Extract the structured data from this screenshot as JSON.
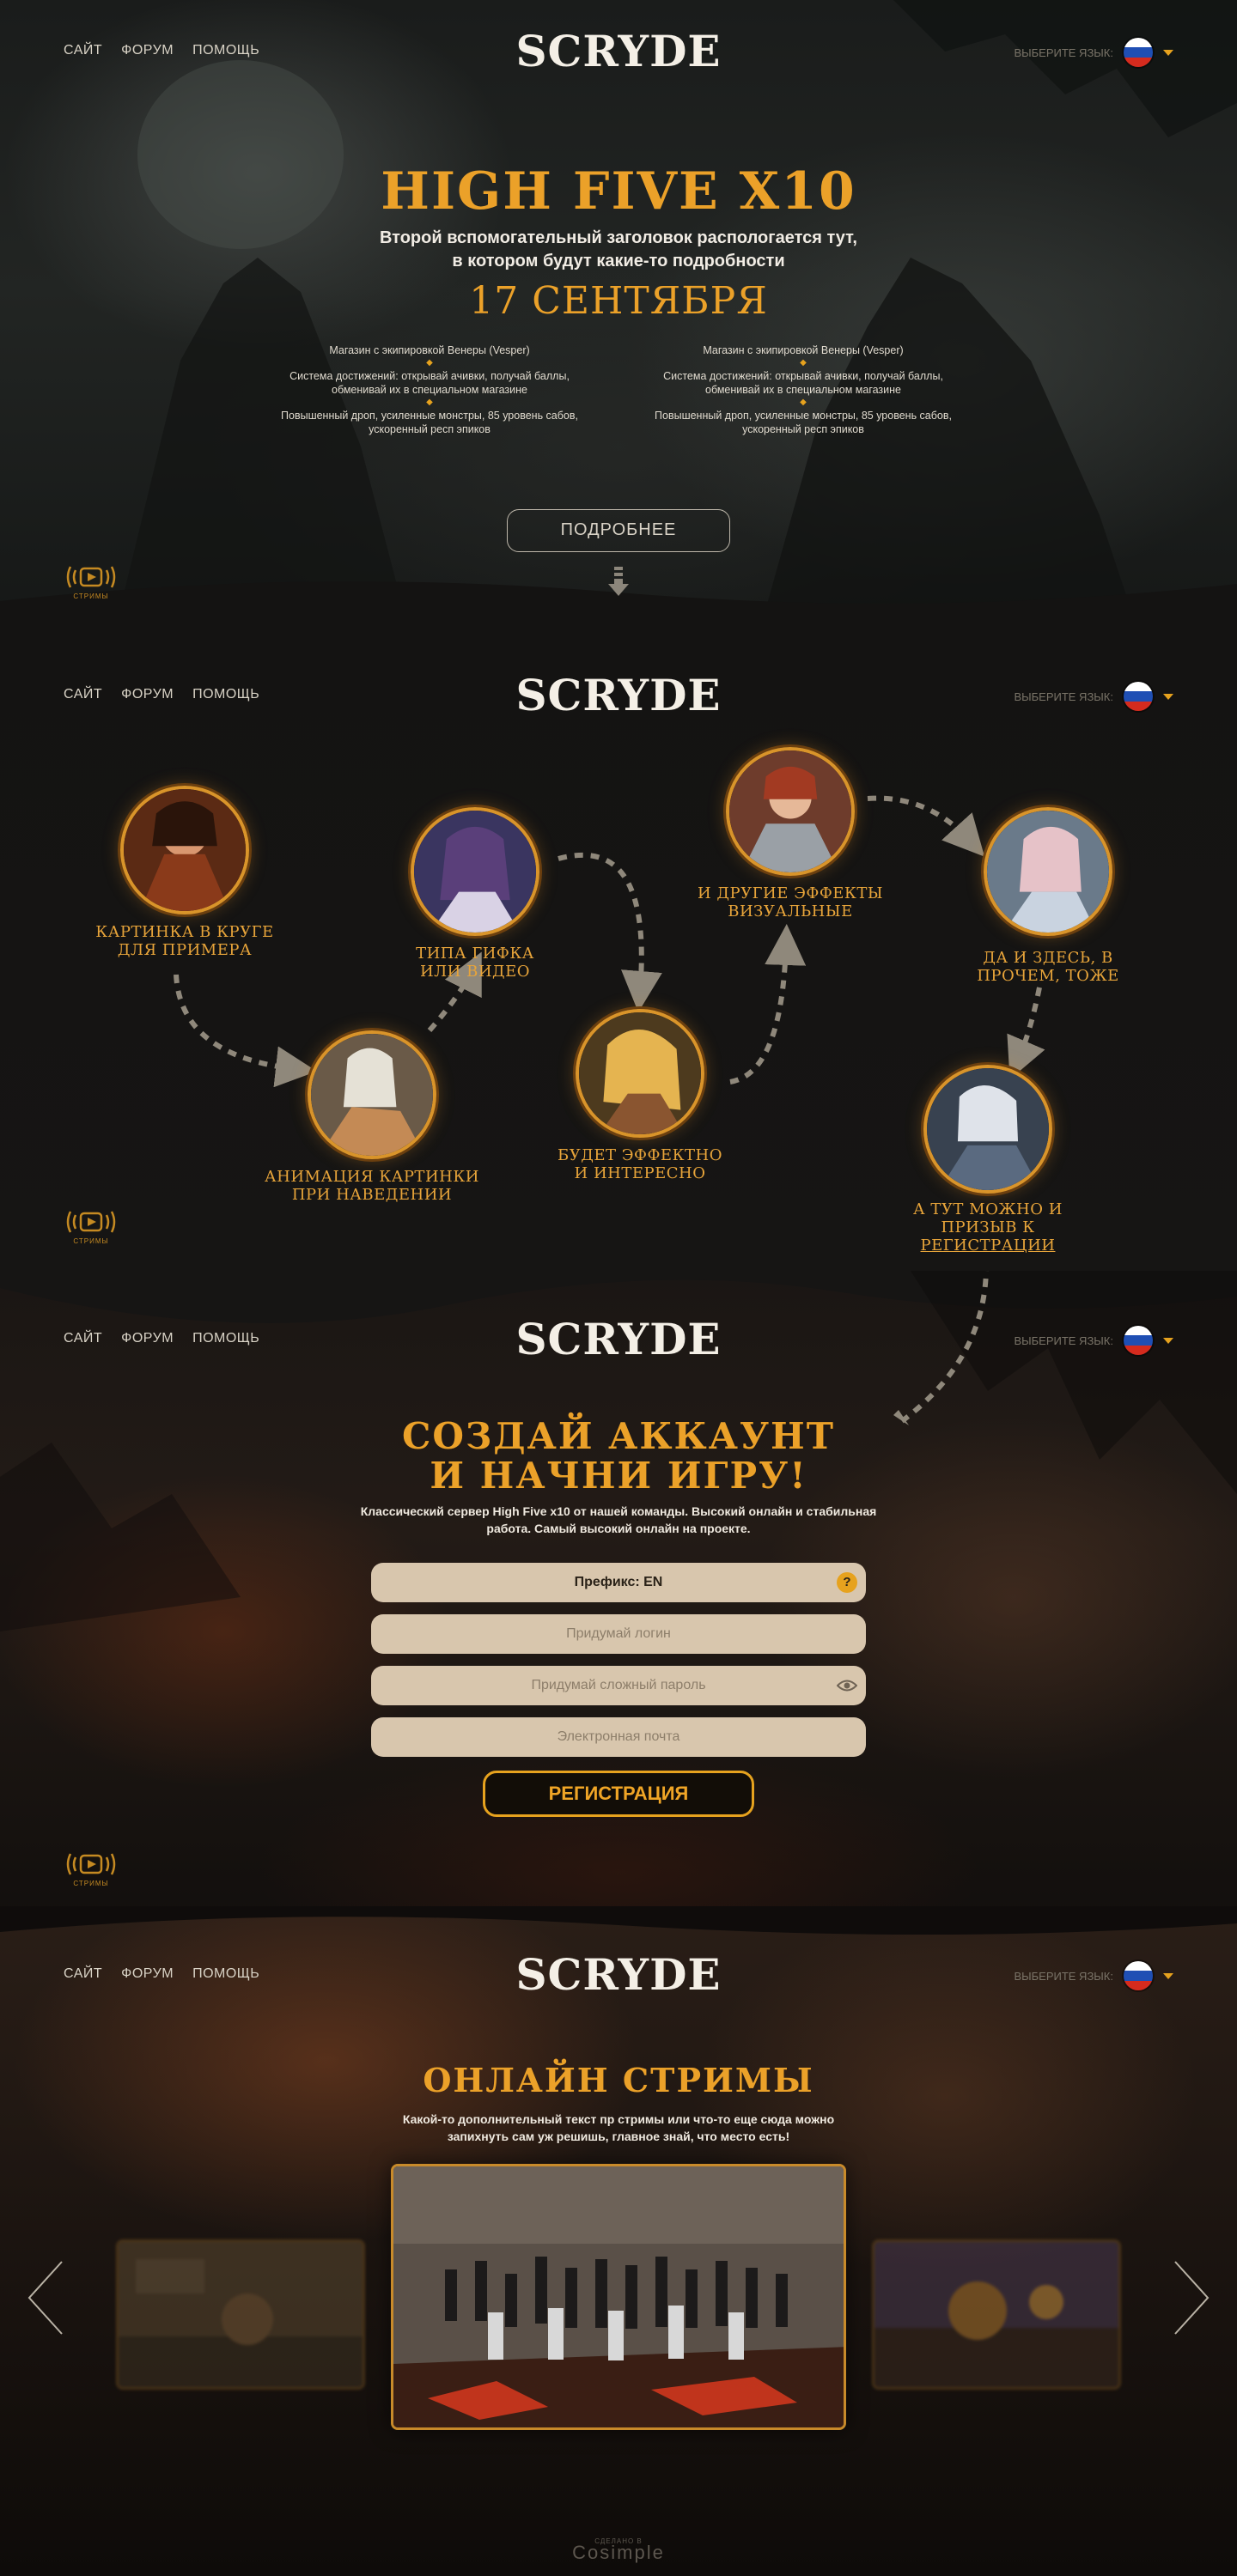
{
  "nav": {
    "links": [
      "САЙТ",
      "ФОРУМ",
      "ПОМОЩЬ"
    ],
    "logo": "SCRYDE",
    "lang_label": "ВЫБЕРИТЕ ЯЗЫК:",
    "lang_flag": "russian-flag-icon"
  },
  "colors": {
    "accent": "#eba129",
    "field_bg": "#d8c6ad",
    "button_border": "#e6a21e"
  },
  "hero": {
    "title": "HIGH FIVE X10",
    "subtitle": "Второй вспомогательный заголовок распологается тут,\nв котором будут какие-то подробности",
    "date": "17 СЕНТЯБРЯ",
    "features_left": [
      "Магазин с экипировкой Венеры (Vesper)",
      "Система достижений:  открывай ачивки, получай баллы,\nобменивай их в специальном магазине",
      "Повышенный дроп, усиленные монстры, 85 уровень сабов,\nускоренный респ эпиков"
    ],
    "features_right": [
      "Магазин с экипировкой Венеры (Vesper)",
      "Система достижений:  открывай ачивки, получай баллы,\nобменивай их в специальном магазине",
      "Повышенный дроп, усиленные монстры, 85 уровень сабов,\nускоренный респ эпиков"
    ],
    "more_button": "ПОДРОБНЕЕ"
  },
  "streams_badge": {
    "label": "СТРИМЫ",
    "icon": "stream-play-icon"
  },
  "path": {
    "nodes": [
      {
        "label": "КАРТИНКА В КРУГЕ\nДЛЯ ПРИМЕРА"
      },
      {
        "label": "АНИМАЦИЯ КАРТИНКИ\nПРИ НАВЕДЕНИИ"
      },
      {
        "label": "ТИПА ГИФКА\nИЛИ ВИДЕО"
      },
      {
        "label": "БУДЕТ ЭФФЕКТНО\nИ ИНТЕРЕСНО"
      },
      {
        "label": "И ДРУГИЕ ЭФФЕКТЫ\nВИЗУАЛЬНЫЕ"
      },
      {
        "label": "ДА И ЗДЕСЬ, В\nПРОЧЕМ, ТОЖЕ"
      },
      {
        "label": "А ТУТ МОЖНО И\nПРИЗЫВ К ",
        "link": "РЕГИСТРАЦИИ"
      }
    ]
  },
  "register": {
    "title": "СОЗДАЙ АККАУНТ\nИ НАЧНИ ИГРУ!",
    "description": "Классический сервер High Five x10 от нашей команды. Высокий онлайн и стабильная\nработа. Самый высокий онлайн на проекте.",
    "prefix": "Префикс: EN",
    "login_placeholder": "Придумай логин",
    "password_placeholder": "Придумай сложный пароль",
    "email_placeholder": "Электронная почта",
    "submit": "РЕГИСТРАЦИЯ"
  },
  "streams": {
    "title": "ОНЛАЙН СТРИМЫ",
    "description": "Какой-то дополнительный текст пр стримы или что-то еще сюда можно\nзапихнуть сам уж решишь, главное знай, что место есть!"
  },
  "footer": {
    "credit_small": "СДЕЛАНО В",
    "credit": "Cosimple"
  }
}
